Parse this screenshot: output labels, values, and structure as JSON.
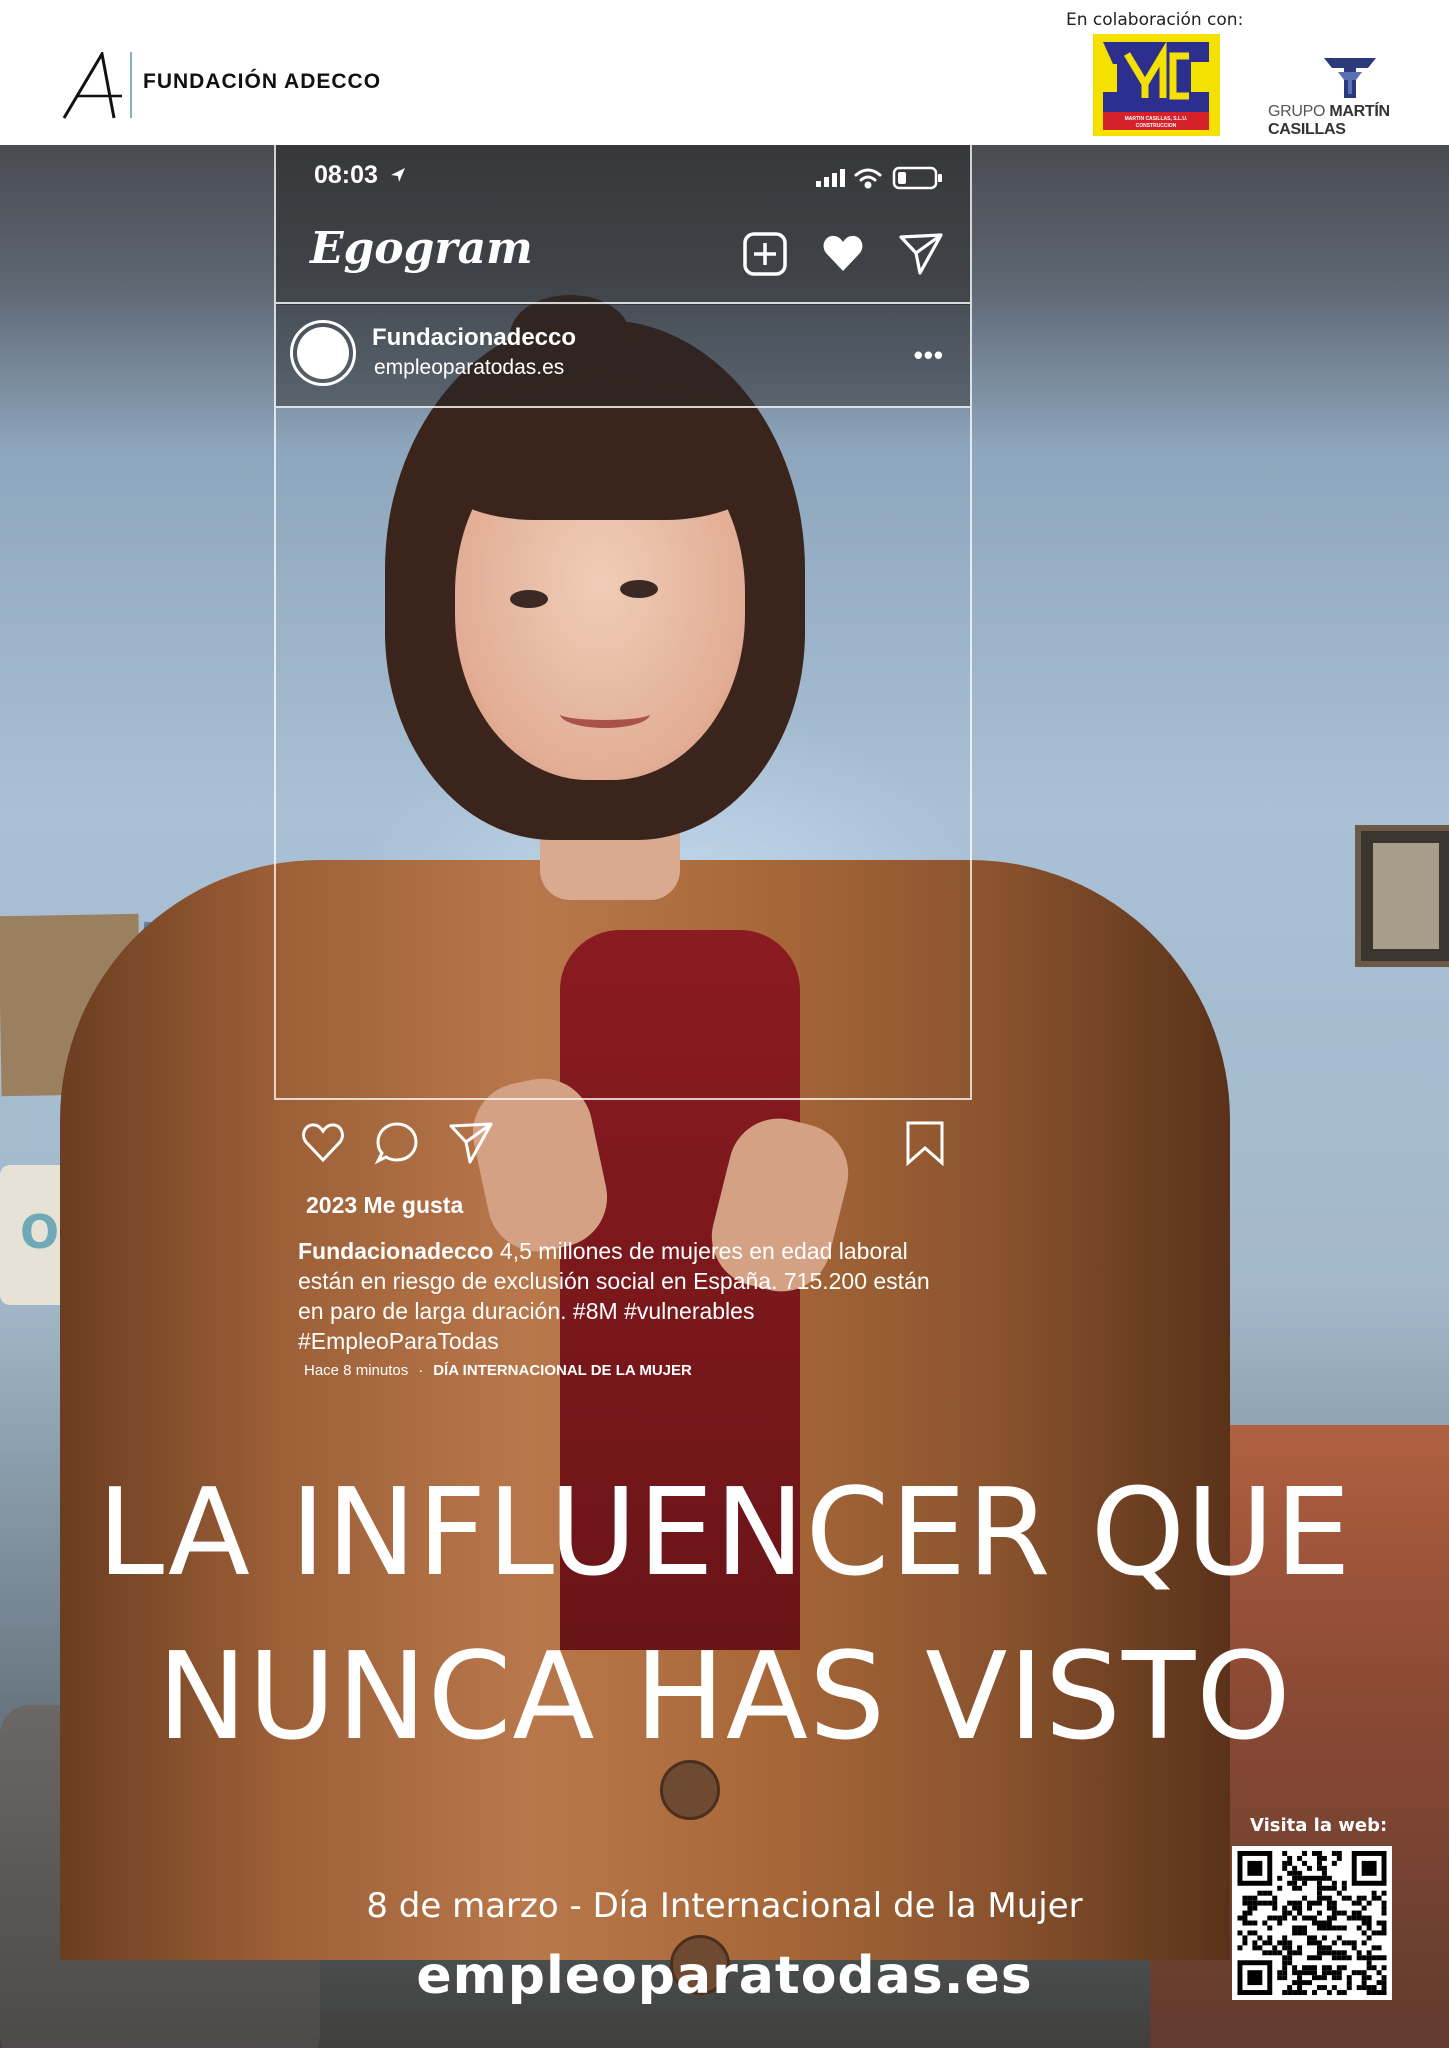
{
  "header": {
    "brand_name": "FUNDACIÓN ADECCO",
    "collab_label": "En colaboración con:",
    "partner_mc_text": "MARTIN CASILLAS, S.L.U. CONSTRUCCION",
    "partner_group_prefix": "GRUPO ",
    "partner_group_name": "MARTÍN CASILLAS"
  },
  "phone": {
    "time": "08:03",
    "app_name": "Egogram",
    "username": "Fundacionadecco",
    "user_url": "empleoparatodas.es",
    "more": "•••"
  },
  "post": {
    "likes": "2023 Me gusta",
    "caption_user": "Fundacionadecco",
    "caption_text": " 4,5 millones de mujeres en edad laboral están en riesgo de exclusión social en España. 715.200 están en paro de larga duración. #8M #vulnerables #EmpleoParaTodas",
    "time_ago": "Hace 8 minutos",
    "separator": "·",
    "event": "DÍA INTERNACIONAL DE LA MUJER"
  },
  "headline": {
    "line1": "LA INFLUENCER QUE",
    "line2": "NUNCA HAS VISTO"
  },
  "footer": {
    "date_line": "8 de marzo - Día Internacional de la Mujer",
    "website": "empleoparatodas.es",
    "qr_label": "Visita la web:"
  },
  "background": {
    "wall_sign": "OLIVIA"
  },
  "colors": {
    "mc_yellow": "#f5e100",
    "mc_blue": "#2d2f8f",
    "mc_red": "#d6202a",
    "adecco_divider": "#7fb3c0",
    "mcs_blue": "#2b3a7a"
  },
  "icons": [
    "location-arrow-icon",
    "signal-icon",
    "wifi-icon",
    "battery-icon",
    "add-post-icon",
    "heart-icon",
    "send-icon",
    "like-icon",
    "comment-icon",
    "share-icon",
    "bookmark-icon",
    "qr-code-icon"
  ]
}
